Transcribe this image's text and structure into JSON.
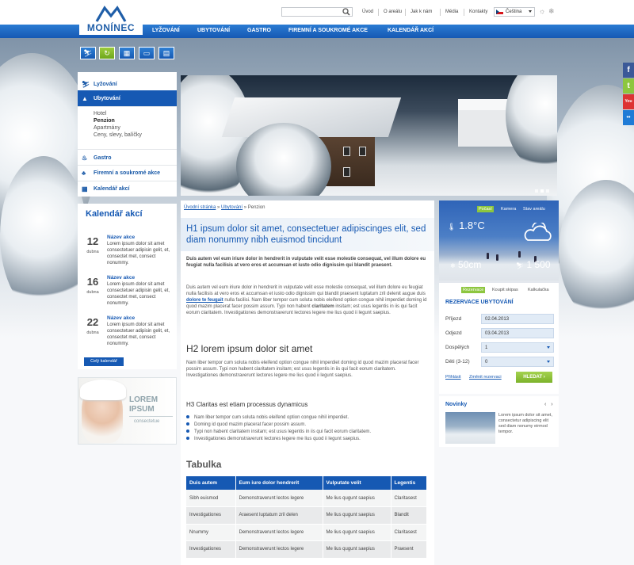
{
  "brand": {
    "logo_text": "MONÍNEC"
  },
  "header": {
    "search_placeholder": "",
    "links": [
      "Úvod",
      "O areálu",
      "Jak k nám",
      "Média",
      "Kontakty"
    ],
    "language": "Čeština"
  },
  "nav": [
    "LYŽOVÁNÍ",
    "UBYTOVÁNÍ",
    "GASTRO",
    "FIREMNÍ A SOUKROMÉ AKCE",
    "KALENDÁŘ AKCÍ"
  ],
  "quick_icons": [
    "skier-icon",
    "refresh-icon",
    "calendar-icon",
    "bus-icon",
    "gallery-icon"
  ],
  "social": [
    "f",
    "t",
    "You",
    "••"
  ],
  "sidebar": {
    "items": [
      {
        "label": "Lyžování",
        "icon": "skier-icon"
      },
      {
        "label": "Ubytování",
        "icon": "lodging-icon"
      },
      {
        "label": "Gastro",
        "icon": "food-icon"
      },
      {
        "label": "Firemní a soukromé akce",
        "icon": "event-icon"
      },
      {
        "label": "Kalendář akcí",
        "icon": "calendar-icon"
      }
    ],
    "subitems": [
      "Hotel",
      "Penzion",
      "Apartmány",
      "Ceny, slevy, balíčky"
    ]
  },
  "calendar": {
    "title": "Kalendář akcí",
    "events": [
      {
        "day": "12",
        "month": "dubna",
        "name": "Název akce",
        "text": "Lorem ipsum dolor sit amet consectetuer adipisin gelit, et, consectet met, consect nonummy."
      },
      {
        "day": "16",
        "month": "dubna",
        "name": "Název akce",
        "text": "Lorem ipsum dolor sit amet consectetuer adipisin gelit, et, consectet met, consect nonummy."
      },
      {
        "day": "22",
        "month": "dubna",
        "name": "Název akce",
        "text": "Lorem ipsum dolor sit amet consectetuer adipisin gelit, et, consectet met, consect nonummy."
      }
    ],
    "button": "Celý kalendář"
  },
  "banner": {
    "line1": "LOREM",
    "line2": "IPSUM",
    "line3": "consectetue"
  },
  "breadcrumb": {
    "home": "Úvodní stránka",
    "section": "Ubytování",
    "current": "Penzion",
    "sep": "»"
  },
  "content": {
    "h1": "H1 ipsum dolor sit amet, consectetuer adipiscinges elit, sed diam nonummy nibh euismod tincidunt",
    "lead": "Duis autem vel eum iriure dolor in hendrerit in vulputate velit esse molestie consequat, vel illum dolore eu feugiat nulla facilisis at vero eros et accumsan et iusto odio dignissim qui blandit praesent.",
    "p2_a": "Duis autem vel eum iriure dolor in hendrerit in vulputate velit esse molestie consequat, vel illum dolore eu feugiat nulla facilisis at vero eros et accumsan et iusto odio dignissim qui blandit praesent luptatum zril delenit augue duis ",
    "p2_link": "dolore te feugait",
    "p2_b": " nulla facilisi. Nam liber tempor cum soluta nobis eleifend option congue nihil imperdiet doming id quod mazim placerat facer possim assum. Typi non habent ",
    "p2_bold": "claritatem",
    "p2_c": " insitam; est usus legentis in iis qui facit eorum claritatem. Investigationes demonstraverunt lectores legere me lius quod ii legunt saepius.",
    "h2": "H2 lorem ipsum dolor sit amet",
    "p3": "Nam liber tempor cum soluta nobis eleifend option congue nihil imperdiet doming id quod mazim placerat facer possim assum. Typi non habent claritatem insitam; est usus legentis in iis qui facit eorum claritatem. Investigationes demonstraverunt lectores legere me lius quod ii legunt saepius.",
    "h3": "H3 Claritas est etiam processus dynamicus",
    "bullets": [
      "Nam liber tempor cum soluta nobis eleifend option congue nihil imperdiet.",
      "Doming id quod mazim placerat facer possim assum.",
      "Typi non habent claritatem insitam; est usus legentis in iis qui facit eorum claritatem.",
      "Investigationes demonstraverunt lectores legere me lius quod ii legunt saepius."
    ],
    "table_title": "Tabulka",
    "table": {
      "headers": [
        "Duis autem",
        "Eum iure dolor hendrerit",
        "Vulputate velit",
        "Legentis"
      ],
      "rows": [
        [
          "Sibh euismod",
          "Demonstraverunt lectos legere",
          "Me lius qugunt saepius",
          "Claritasest"
        ],
        [
          "Investigationes",
          "Araesent luptatum zril delen",
          "Me lius qugunt saepius",
          "Blandit"
        ],
        [
          "Nnummy",
          "Demonstraverunt lectos legere",
          "Me lius qugunt saepius",
          "Claritasest"
        ],
        [
          "Investigationes",
          "Demonstraverunt lectos legere",
          "Me lius qugunt saepius",
          "Praesent"
        ]
      ]
    }
  },
  "weather": {
    "tabs": [
      "Počasí",
      "Kamera",
      "Stav areálu"
    ],
    "temp": "1.8°C",
    "snow": "50cm",
    "skiers": "1 500"
  },
  "reservation": {
    "tabs": [
      "Rezervace",
      "Koupit skipas",
      "Kalkulačka"
    ],
    "title": "REZERVACE UBYTOVÁNÍ",
    "fields": [
      {
        "label": "Příjezd",
        "value": "02.04.2013"
      },
      {
        "label": "Odjezd",
        "value": "03.04.2013"
      },
      {
        "label": "Dospělých",
        "value": "1"
      },
      {
        "label": "Děti (3-12)",
        "value": "0"
      }
    ],
    "login": "Přihlásit",
    "change": "Změnit rezervaci",
    "search": "HLEDAT"
  },
  "news": {
    "title": "Novinky",
    "arrows": "‹ ›",
    "text": "Lorem ipsum dolor sit amet, consectetur adipiscing elit sed diam nonumy eirmod tempor."
  },
  "colors": {
    "brand_blue": "#1659b3",
    "accent_green": "#8dc63f"
  }
}
